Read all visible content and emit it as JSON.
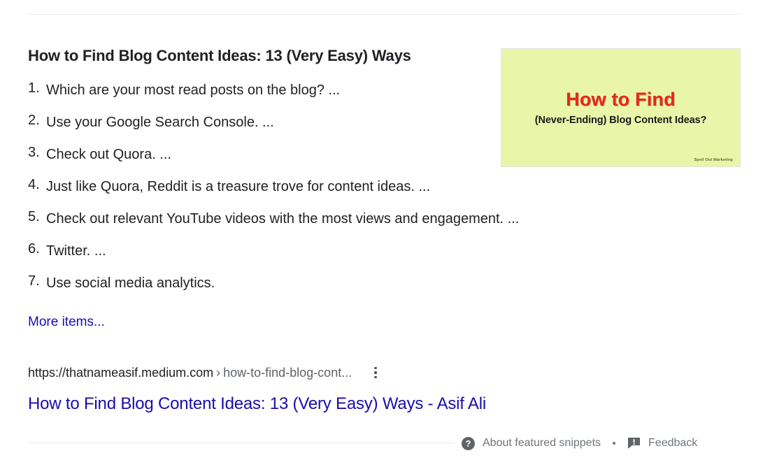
{
  "snippet": {
    "heading": "How to Find Blog Content Ideas: 13 (Very Easy) Ways",
    "items": [
      {
        "num": "1.",
        "text": "Which are your most read posts on the blog? ..."
      },
      {
        "num": "2.",
        "text": "Use your Google Search Console. ..."
      },
      {
        "num": "3.",
        "text": "Check out Quora. ..."
      },
      {
        "num": "4.",
        "text": "Just like Quora, Reddit is a treasure trove for content ideas. ..."
      },
      {
        "num": "5.",
        "text": "Check out relevant YouTube videos with the most views and engagement. ..."
      },
      {
        "num": "6.",
        "text": "Twitter. ..."
      },
      {
        "num": "7.",
        "text": "Use social media analytics."
      }
    ],
    "more_items_label": "More items..."
  },
  "thumbnail": {
    "title": "How to Find",
    "subtitle": "(Never-Ending) Blog Content Ideas?",
    "watermark": "Spell Out Marketing",
    "background_color": "#e9f5a9",
    "title_color": "#e8251f"
  },
  "result": {
    "url_domain": "https://thatnameasif.medium.com",
    "url_separator": "›",
    "url_path": "how-to-find-blog-cont...",
    "title": "How to Find Blog Content Ideas: 13 (Very Easy) Ways - Asif Ali",
    "menu_icon": "kebab-menu-icon",
    "link_color": "#1a0dab"
  },
  "footer": {
    "help_icon": "question-mark-icon",
    "about_label": "About featured snippets",
    "separator": "•",
    "feedback_icon": "feedback-flag-icon",
    "feedback_label": "Feedback"
  }
}
